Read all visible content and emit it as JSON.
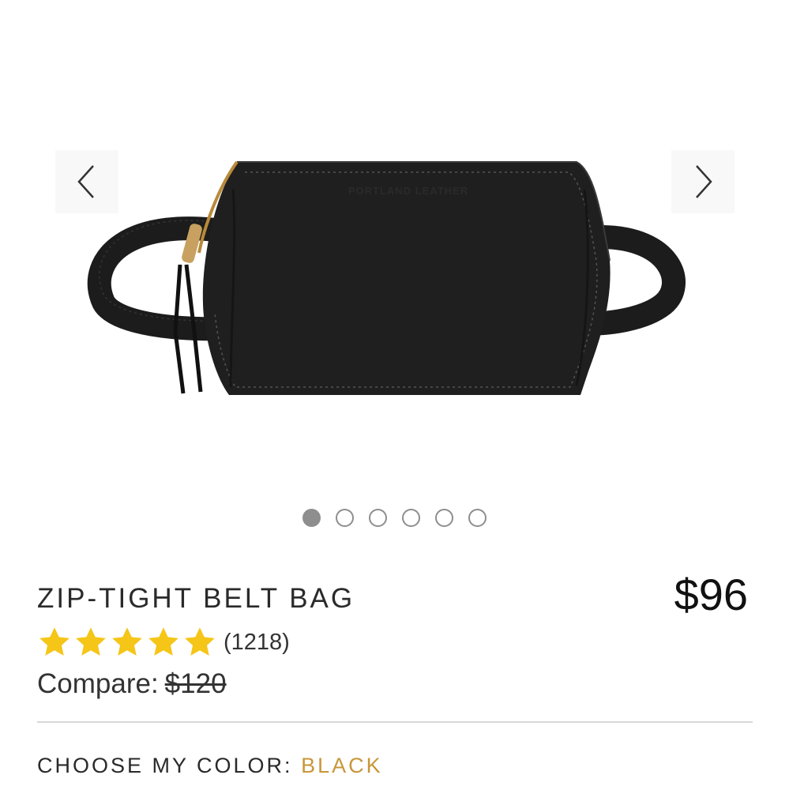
{
  "gallery": {
    "image_alt": "Black leather zip belt bag with strap",
    "emboss_text": "PORTLAND LEATHER",
    "slide_count": 6,
    "active_slide": 1,
    "prev_icon": "chevron-left-icon",
    "next_icon": "chevron-right-icon"
  },
  "product": {
    "title": "ZIP-TIGHT BELT BAG",
    "price": "$96",
    "rating": 5,
    "review_count": "(1218)",
    "compare_label": "Compare:",
    "compare_price": "$120"
  },
  "color": {
    "label": "CHOOSE MY COLOR:",
    "value": "BLACK"
  },
  "colors": {
    "star": "#f5c518",
    "accent": "#c9963a",
    "dot": "#8e8e8e",
    "bag": "#1e1e1e"
  }
}
